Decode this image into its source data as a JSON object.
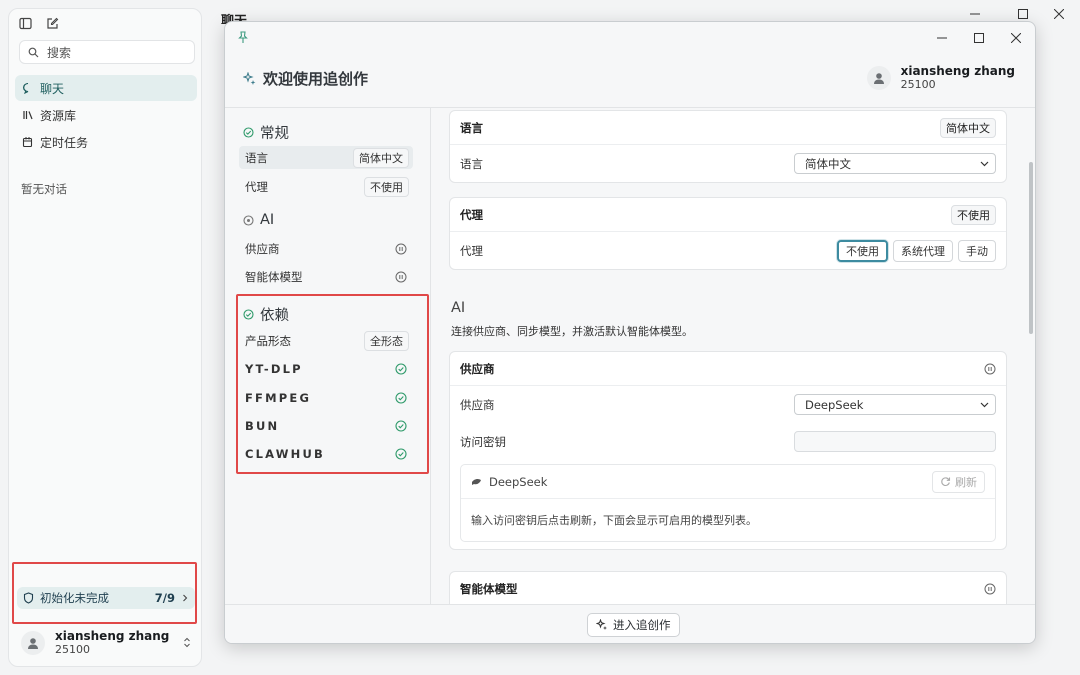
{
  "bg": {
    "title": "聊天",
    "search_placeholder": "搜索",
    "nav": [
      {
        "label": "聊天"
      },
      {
        "label": "资源库"
      },
      {
        "label": "定时任务"
      }
    ],
    "empty": "暂无对话",
    "init_label": "初始化未完成",
    "init_count": "7/9",
    "user_name": "xiansheng zhang",
    "user_id": "25100"
  },
  "dialog": {
    "title": "欢迎使用追创作",
    "user_name": "xiansheng zhang",
    "user_id": "25100",
    "enter_button": "进入追创作"
  },
  "nav": {
    "general": "常规",
    "lang_label": "语言",
    "lang_value": "简体中文",
    "proxy_label": "代理",
    "proxy_value": "不使用",
    "ai": "AI",
    "provider": "供应商",
    "agent_model": "智能体模型",
    "deps": "依赖",
    "product_form": "产品形态",
    "product_value": "全形态",
    "dep_items": [
      {
        "label": "YT-DLP"
      },
      {
        "label": "FFMPEG"
      },
      {
        "label": "BUN"
      },
      {
        "label": "CLAWHUB"
      }
    ]
  },
  "content": {
    "lang_card_title": "语言",
    "lang_tag": "简体中文",
    "lang_row": "语言",
    "lang_select": "简体中文",
    "proxy_card_title": "代理",
    "proxy_tag": "不使用",
    "proxy_row": "代理",
    "proxy_opts": [
      "不使用",
      "系统代理",
      "手动"
    ],
    "ai_heading": "AI",
    "ai_desc": "连接供应商、同步模型，并激活默认智能体模型。",
    "provider_card_title": "供应商",
    "provider_row": "供应商",
    "provider_select": "DeepSeek",
    "key_row": "访问密钥",
    "key_value": "",
    "ds_name": "DeepSeek",
    "refresh": "刷新",
    "hint": "输入访问密钥后点击刷新，下面会显示可启用的模型列表。",
    "agent_card_title": "智能体模型"
  },
  "colors": {
    "accent": "#1f5f5f",
    "success": "#2e9a6a",
    "highlight": "#e04848",
    "focus": "#3d8ba0"
  }
}
